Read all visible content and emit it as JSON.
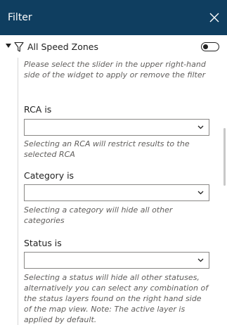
{
  "header": {
    "title": "Filter",
    "close_icon": "close-icon"
  },
  "main_filter": {
    "label": "All Speed Zones",
    "icon": "funnel-icon",
    "toggle_on": true,
    "hint": "Please select the slider in the upper right-hand side of the widget to apply or remove the filter"
  },
  "sections": [
    {
      "label": "RCA is",
      "value": "",
      "hint": "Selecting an RCA will restrict results to the selected RCA"
    },
    {
      "label": "Category is",
      "value": "",
      "hint": "Selecting a category will hide all other categories"
    },
    {
      "label": "Status is",
      "value": "",
      "hint": "Selecting a status will hide all other statuses, alternatively you can select any combination of the status layers found on the right hand side of the map view. Note: The active layer is applied by default."
    }
  ],
  "colors": {
    "header_bg": "#0f3e60",
    "header_text": "#ffffff",
    "hint_text": "#605e5c"
  }
}
